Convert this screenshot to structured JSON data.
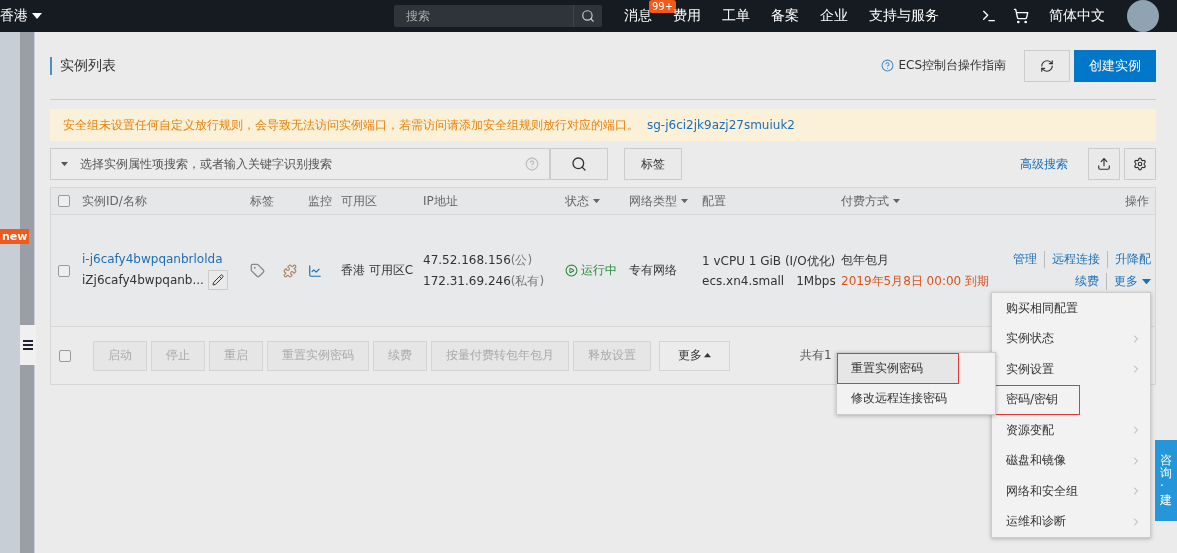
{
  "topbar": {
    "region": "香港",
    "search": {
      "placeholder": "搜索"
    },
    "nav": [
      {
        "label": "消息",
        "badge": "99+"
      },
      {
        "label": "费用"
      },
      {
        "label": "工单"
      },
      {
        "label": "备案"
      },
      {
        "label": "企业"
      },
      {
        "label": "支持与服务"
      }
    ],
    "language": "简体中文"
  },
  "sidebar": {
    "badge": "new"
  },
  "page": {
    "title": "实例列表",
    "guide": "ECS控制台操作指南",
    "create_button": "创建实例"
  },
  "alert": {
    "text": "安全组未设置任何自定义放行规则，会导致无法访问实例端口，若需访问请添加安全组规则放行对应的端口。",
    "link": "sg-j6ci2jk9azj27smuiuk2"
  },
  "search": {
    "placeholder": "选择实例属性项搜索，或者输入关键字识别搜索",
    "tag_button": "标签",
    "advanced": "高级搜索"
  },
  "table": {
    "header_checked": false,
    "columns": [
      {
        "label": "实例ID/名称",
        "sortable": false
      },
      {
        "label": "标签",
        "sortable": false
      },
      {
        "label": "监控",
        "sortable": false
      },
      {
        "label": "可用区",
        "sortable": false
      },
      {
        "label": "IP地址",
        "sortable": false
      },
      {
        "label": "状态",
        "sortable": true
      },
      {
        "label": "网络类型",
        "sortable": true
      },
      {
        "label": "配置",
        "sortable": false
      },
      {
        "label": "付费方式",
        "sortable": true
      },
      {
        "label": "操作",
        "sortable": false
      }
    ],
    "rows": [
      {
        "checked": false,
        "id": "i-j6cafy4bwpqanbrlolda",
        "name": "iZj6cafy4bwpqanb...",
        "zone": "香港 可用区C",
        "ip_public": "47.52.168.156",
        "ip_public_tag": "(公)",
        "ip_private": "172.31.69.246",
        "ip_private_tag": "(私有)",
        "status": "运行中",
        "network": "专有网络",
        "config_1": "1 vCPU 1 GiB (I/O优化)",
        "config_2": "ecs.xn4.small",
        "bandwidth": "1Mbps",
        "billing": "包年包月",
        "expiry": "2019年5月8日 00:00 到期",
        "actions": [
          "管理",
          "远程连接",
          "升降配",
          "续费",
          "更多"
        ]
      }
    ],
    "footer": {
      "checked": false,
      "buttons": [
        {
          "label": "启动",
          "disabled": true
        },
        {
          "label": "停止",
          "disabled": true
        },
        {
          "label": "重启",
          "disabled": true
        },
        {
          "label": "重置实例密码",
          "disabled": true
        },
        {
          "label": "续费",
          "disabled": true
        },
        {
          "label": "按量付费转包年包月",
          "disabled": true
        },
        {
          "label": "释放设置",
          "disabled": true
        },
        {
          "label": "更多",
          "disabled": false
        }
      ],
      "pagination": "共有1"
    }
  },
  "more_menu": [
    {
      "label": "购买相同配置",
      "submenu": false,
      "outlined": false
    },
    {
      "label": "实例状态",
      "submenu": true,
      "outlined": false
    },
    {
      "label": "实例设置",
      "submenu": true,
      "outlined": false
    },
    {
      "label": "密码/密钥",
      "submenu": false,
      "outlined": true
    },
    {
      "label": "资源变配",
      "submenu": true,
      "outlined": false
    },
    {
      "label": "磁盘和镜像",
      "submenu": true,
      "outlined": false
    },
    {
      "label": "网络和安全组",
      "submenu": true,
      "outlined": false
    },
    {
      "label": "运维和诊断",
      "submenu": true,
      "outlined": false
    }
  ],
  "submenu": [
    {
      "label": "重置实例密码",
      "selected": true,
      "outlined": true
    },
    {
      "label": "修改远程连接密码",
      "selected": false,
      "outlined": false
    }
  ],
  "feedback_tab": "咨询·建"
}
